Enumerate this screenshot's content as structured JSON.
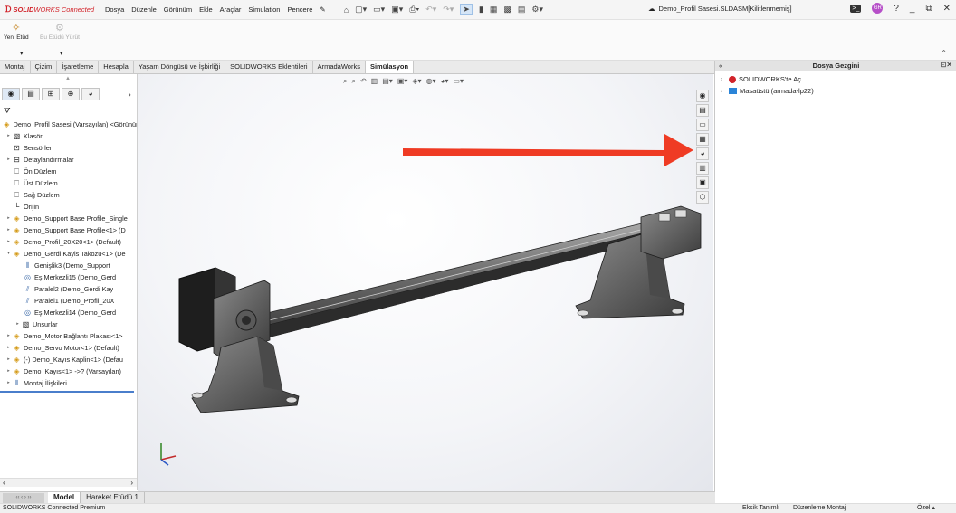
{
  "app": {
    "brand_strong": "SOLID",
    "brand_rest": "WORKS Connected",
    "menus": [
      "Dosya",
      "Düzenle",
      "Görünüm",
      "Ekle",
      "Araçlar",
      "Simulation",
      "Pencere"
    ],
    "document_title": "Demo_Profil Sasesi.SLDASM[Kilitlenmemiş]",
    "avatar_initials": "GR"
  },
  "ribbon": {
    "new_study": "Yeni Etüd",
    "this_study": "Bu Etüdü Yürüt"
  },
  "command_tabs": [
    "Montaj",
    "Çizim",
    "İşaretleme",
    "Hesapla",
    "Yaşam Döngüsü ve İşbirliği",
    "SOLIDWORKS Eklentileri",
    "ArmadaWorks",
    "Simülasyon"
  ],
  "active_command_tab": "Simülasyon",
  "tree": {
    "items": [
      {
        "label": "Demo_Profil Sasesi (Varsayılan) <Görünüm",
        "icon": "assembly-icon",
        "level": 0
      },
      {
        "label": "Klasör",
        "icon": "folder-icon",
        "level": 1
      },
      {
        "label": "Sensörler",
        "icon": "sensor-icon",
        "level": 1
      },
      {
        "label": "Detaylandırmalar",
        "icon": "annotation-icon",
        "level": 1
      },
      {
        "label": "Ön Düzlem",
        "icon": "plane-icon",
        "level": 1
      },
      {
        "label": "Üst Düzlem",
        "icon": "plane-icon",
        "level": 1
      },
      {
        "label": "Sağ Düzlem",
        "icon": "plane-icon",
        "level": 1
      },
      {
        "label": "Orijin",
        "icon": "origin-icon",
        "level": 1
      },
      {
        "label": "Demo_Support Base Profile_Single",
        "icon": "part-icon",
        "level": 1
      },
      {
        "label": "Demo_Support Base Profile<1> (D",
        "icon": "part-icon",
        "level": 1
      },
      {
        "label": "Demo_Profil_20X20<1> (Default)",
        "icon": "part-icon",
        "level": 1
      },
      {
        "label": "Demo_Gerdi Kayis Takozu<1> (De",
        "icon": "part-icon",
        "level": 1
      },
      {
        "label": "Genişlik3 (Demo_Support",
        "icon": "mate-icon",
        "level": 2
      },
      {
        "label": "Eş Merkezli15 (Demo_Gerd",
        "icon": "mate-icon",
        "level": 2
      },
      {
        "label": "Paralel2 (Demo_Gerdi Kay",
        "icon": "mate-icon",
        "level": 2
      },
      {
        "label": "Paralel1 (Demo_Profil_20X",
        "icon": "mate-icon",
        "level": 2
      },
      {
        "label": "Eş Merkezli14 (Demo_Gerd",
        "icon": "mate-icon",
        "level": 2
      },
      {
        "label": "Unsurlar",
        "icon": "features-icon",
        "level": 3
      },
      {
        "label": "Demo_Motor Bağlantı Plakası<1>",
        "icon": "part-icon",
        "level": 1
      },
      {
        "label": "Demo_Servo Motor<1> (Default)",
        "icon": "part-icon",
        "level": 1
      },
      {
        "label": "(-) Demo_Kayıs Kaplin<1> (Defau",
        "icon": "part-icon",
        "level": 1
      },
      {
        "label": "Demo_Kayıs<1> ->? (Varsayılan)",
        "icon": "part-icon",
        "level": 1
      },
      {
        "label": "Montaj İlişkileri",
        "icon": "mates-folder-icon",
        "level": 1
      }
    ]
  },
  "bottom_tabs": [
    "Model",
    "Hareket Etüdü 1"
  ],
  "active_bottom_tab": "Model",
  "status": {
    "product": "SOLIDWORKS Connected Premium",
    "undefined": "Eksik Tanımlı",
    "editing": "Düzenleme Montaj",
    "units": "Özel"
  },
  "right_pane": {
    "title": "Dosya Gezgini",
    "items": [
      "SOLIDWORKS'te Aç",
      "Masaüstü (armada-lp22)"
    ]
  },
  "colors": {
    "brand": "#d2232a",
    "arrow": "#ef3b24",
    "accent_blue": "#4a7ecb"
  }
}
